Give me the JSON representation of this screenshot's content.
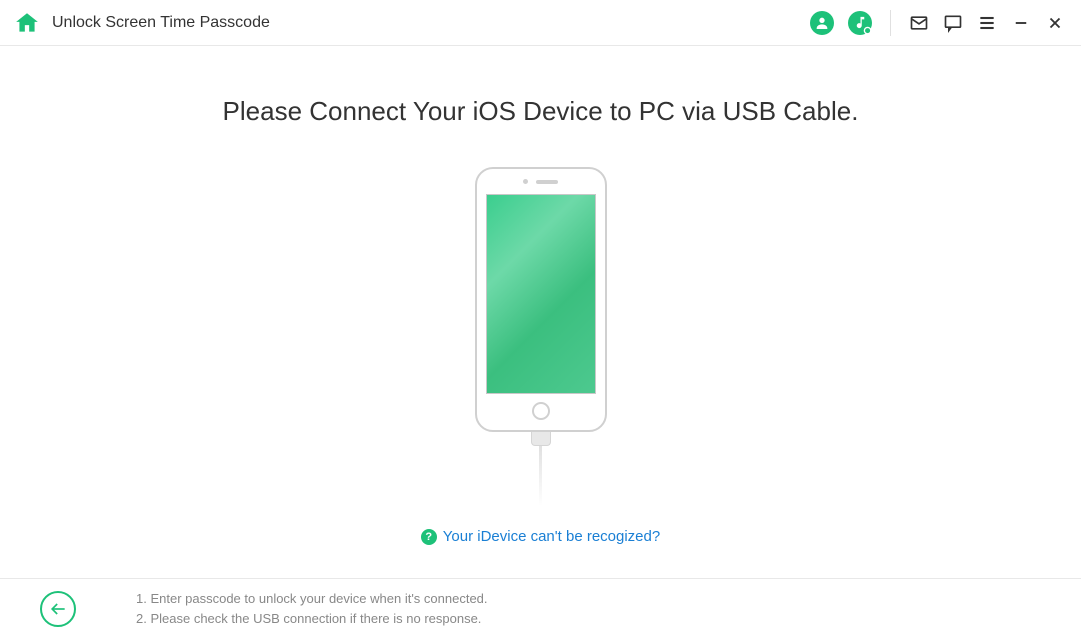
{
  "titlebar": {
    "title": "Unlock Screen Time Passcode"
  },
  "main": {
    "headline": "Please Connect Your iOS Device to PC via USB Cable.",
    "help_link": "Your iDevice can't be recogized?"
  },
  "footer": {
    "line1": "1. Enter passcode to unlock your device when it's connected.",
    "line2": "2. Please check the USB connection if there is no response."
  }
}
